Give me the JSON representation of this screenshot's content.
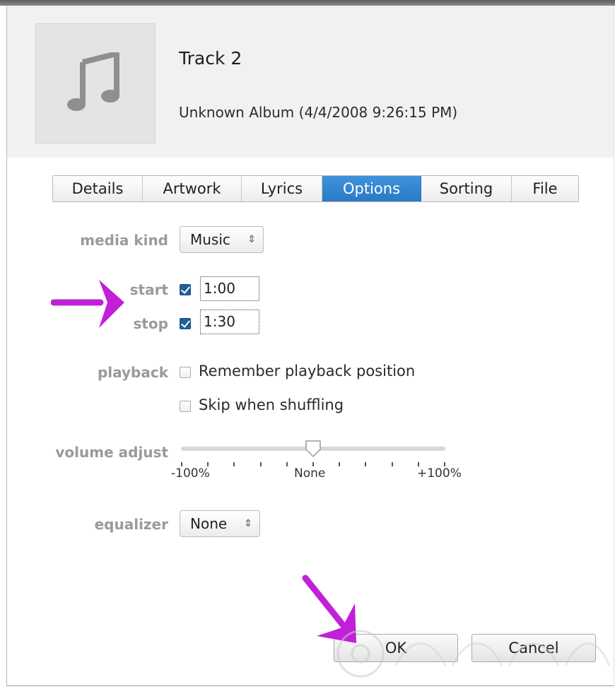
{
  "track": {
    "title": "Track 2",
    "album_line": "Unknown Album (4/4/2008 9:26:15 PM)",
    "artwork_icon": "music-note-icon"
  },
  "tabs": [
    {
      "label": "Details",
      "active": false
    },
    {
      "label": "Artwork",
      "active": false
    },
    {
      "label": "Lyrics",
      "active": false
    },
    {
      "label": "Options",
      "active": true
    },
    {
      "label": "Sorting",
      "active": false
    },
    {
      "label": "File",
      "active": false
    }
  ],
  "options": {
    "media_kind": {
      "label": "media kind",
      "value": "Music"
    },
    "start": {
      "label": "start",
      "checked": true,
      "value": "1:00"
    },
    "stop": {
      "label": "stop",
      "checked": true,
      "value": "1:30"
    },
    "playback": {
      "label": "playback",
      "remember_position": {
        "label": "Remember playback position",
        "checked": false
      },
      "skip_shuffling": {
        "label": "Skip when shuffling",
        "checked": false
      }
    },
    "volume_adjust": {
      "label": "volume adjust",
      "min_label": "-100%",
      "mid_label": "None",
      "max_label": "+100%",
      "value_percent": 0
    },
    "equalizer": {
      "label": "equalizer",
      "value": "None"
    }
  },
  "buttons": {
    "ok": "OK",
    "cancel": "Cancel"
  },
  "colors": {
    "active_tab": "#2f84d0",
    "checkbox_checked": "#1f5f9c",
    "annotation_arrow": "#c21fd9"
  }
}
